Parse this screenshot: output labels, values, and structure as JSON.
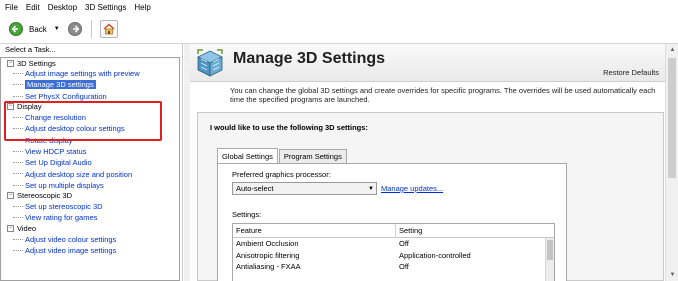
{
  "menu": [
    "File",
    "Edit",
    "Desktop",
    "3D Settings",
    "Help"
  ],
  "toolbar": {
    "back_label": "Back",
    "back_icon": "back-arrow-icon",
    "forward_icon": "forward-arrow-icon",
    "home_icon": "home-icon"
  },
  "sidebar": {
    "header": "Select a Task...",
    "categories": [
      {
        "label": "3D Settings",
        "items": [
          "Adjust image settings with preview",
          "Manage 3D settings",
          "Set PhysX Configuration"
        ]
      },
      {
        "label": "Display",
        "items": [
          "Change resolution",
          "Adjust desktop colour settings",
          "Rotate display",
          "View HDCP status",
          "Set Up Digital Audio",
          "Adjust desktop size and position",
          "Set up multiple displays"
        ]
      },
      {
        "label": "Stereoscopic 3D",
        "items": [
          "Set up stereoscopic 3D",
          "View rating for games"
        ]
      },
      {
        "label": "Video",
        "items": [
          "Adjust video colour settings",
          "Adjust video image settings"
        ]
      }
    ],
    "selected": "Manage 3D settings"
  },
  "main": {
    "title": "Manage 3D Settings",
    "restore_label": "Restore Defaults",
    "description": "You can change the global 3D settings and create overrides for specific programs. The overrides will be used automatically each time the specified programs are launched.",
    "section_title": "I would like to use the following 3D settings:",
    "tabs": [
      "Global Settings",
      "Program Settings"
    ],
    "active_tab": "Global Settings",
    "preferred_gpu_label": "Preferred graphics processor:",
    "preferred_gpu_value": "Auto-select",
    "manage_updates_link": "Manage updates...",
    "settings_label": "Settings:",
    "grid_headers": [
      "Feature",
      "Setting"
    ],
    "grid_rows": [
      [
        "Ambient Occlusion",
        "Off"
      ],
      [
        "Anisotropic filtering",
        "Application-controlled"
      ],
      [
        "Antialiasing - FXAA",
        "Off"
      ]
    ]
  },
  "colors": {
    "link": "#0033cc",
    "selected_bg": "#3b6fd6",
    "highlight_border": "#e02020"
  }
}
